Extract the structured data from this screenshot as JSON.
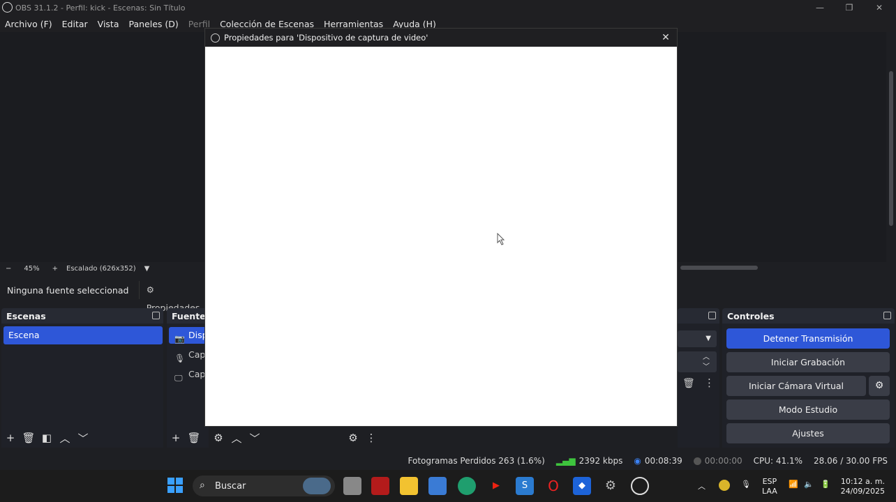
{
  "window": {
    "title": "OBS 31.1.2 - Perfil: kick - Escenas: Sin Título",
    "minimize": "—",
    "restore": "❐",
    "close": "✕"
  },
  "menu": [
    "Archivo (F)",
    "Editar",
    "Vista",
    "Paneles (D)",
    "Perfil",
    "Colección de Escenas",
    "Herramientas",
    "Ayuda (H)"
  ],
  "preview_bar": {
    "zoom_out": "−",
    "zoom": "45%",
    "zoom_in": "+",
    "scale": "Escalado (626x352)"
  },
  "source_bar": {
    "no_source": "Ninguna fuente seleccionad",
    "properties": "Propiedades"
  },
  "scenes": {
    "title": "Escenas",
    "items": [
      "Escena"
    ]
  },
  "sources": {
    "title": "Fuentes",
    "items": [
      "Dispositivo de captura de video",
      "Captura de entrada de audio",
      "Captura de pantalla"
    ]
  },
  "controls": {
    "title": "Controles",
    "stop_stream": "Detener Transmisión",
    "start_recording": "Iniciar Grabación",
    "start_virtual_cam": "Iniciar Cámara Virtual",
    "studio_mode": "Modo Estudio",
    "settings": "Ajustes"
  },
  "dialog": {
    "title": "Propiedades para 'Dispositivo de captura de video'"
  },
  "status": {
    "dropped_frames": "Fotogramas Perdidos 263 (1.6%)",
    "bitrate": "2392 kbps",
    "stream_time": "00:08:39",
    "rec_time": "00:00:00",
    "cpu": "CPU: 41.1%",
    "fps": "28.06 / 30.00 FPS",
    "colors": {
      "live": "#3b82f6",
      "bitrate": "#3ec43e"
    }
  },
  "taskbar": {
    "search_placeholder": "Buscar",
    "lang_top": "ESP",
    "lang_bottom": "LAA",
    "time": "10:12 a. m.",
    "date": "24/09/2025"
  },
  "colors": {
    "accent": "#2e57d8",
    "background": "#1e1f23",
    "dock": "#272a33"
  }
}
